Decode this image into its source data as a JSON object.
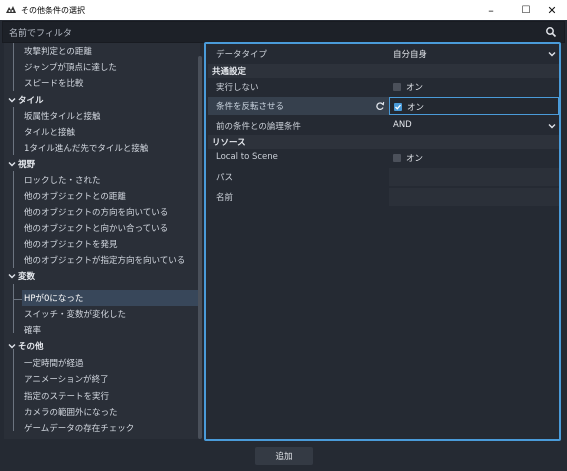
{
  "window": {
    "title": "その他条件の選択",
    "minimize": "–",
    "maximize": "☐",
    "close": "✕"
  },
  "filter": {
    "placeholder": "名前でフィルタ"
  },
  "tree": {
    "rows": [
      {
        "type": "item",
        "label": "攻撃判定との距離"
      },
      {
        "type": "item",
        "label": "ジャンプが頂点に達した"
      },
      {
        "type": "item",
        "label": "スピードを比較"
      },
      {
        "type": "cat",
        "label": "タイル"
      },
      {
        "type": "item",
        "label": "坂属性タイルと接触"
      },
      {
        "type": "item",
        "label": "タイルと接触"
      },
      {
        "type": "item",
        "label": "1タイル進んだ先でタイルと接触"
      },
      {
        "type": "cat",
        "label": "視野"
      },
      {
        "type": "item",
        "label": "ロックした・された"
      },
      {
        "type": "item",
        "label": "他のオブジェクトとの距離"
      },
      {
        "type": "item",
        "label": "他のオブジェクトの方向を向いている"
      },
      {
        "type": "item",
        "label": "他のオブジェクトと向かい合っている"
      },
      {
        "type": "item",
        "label": "他のオブジェクトを発見"
      },
      {
        "type": "item",
        "label": "他のオブジェクトが指定方向を向いている"
      },
      {
        "type": "cat",
        "label": "変数"
      },
      {
        "type": "selected",
        "label": "HPが0になった"
      },
      {
        "type": "item",
        "label": "スイッチ・変数が変化した"
      },
      {
        "type": "item",
        "label": "確率"
      },
      {
        "type": "cat",
        "label": "その他"
      },
      {
        "type": "item",
        "label": "一定時間が経過"
      },
      {
        "type": "item",
        "label": "アニメーションが終了"
      },
      {
        "type": "item",
        "label": "指定のステートを実行"
      },
      {
        "type": "item",
        "label": "カメラの範囲外になった"
      },
      {
        "type": "item",
        "label": "ゲームデータの存在チェック"
      }
    ]
  },
  "inspector": {
    "data_type_label": "データタイプ",
    "data_type_value": "自分自身",
    "common_section": "共通設定",
    "disabled_label": "実行しない",
    "disabled_value": "オン",
    "invert_label": "条件を反転させる",
    "invert_value": "オン",
    "logic_label": "前の条件との論理条件",
    "logic_value": "AND",
    "resource_section": "リソース",
    "local_label": "Local to Scene",
    "local_value": "オン",
    "path_label": "パス",
    "name_label": "名前"
  },
  "footer": {
    "add_label": "追加"
  },
  "colors": {
    "accent": "#4a9bd9",
    "background": "#252a33",
    "selected_row": "#38475a"
  }
}
